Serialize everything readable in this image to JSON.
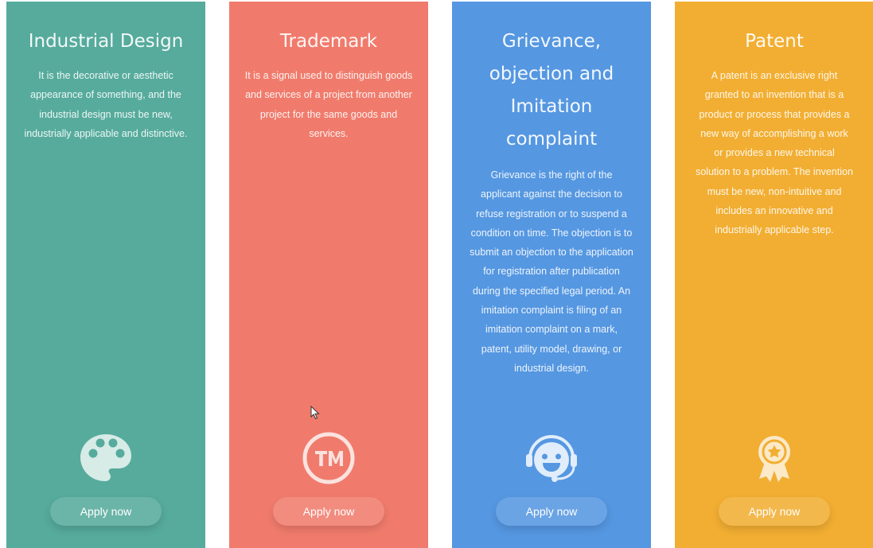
{
  "cards": [
    {
      "title": "Industrial Design",
      "description": "It is the decorative or aesthetic appearance of something, and the industrial design must be new, industrially applicable and distinctive.",
      "icon": "palette-icon",
      "button_label": "Apply now",
      "color": "#56AB9C"
    },
    {
      "title": "Trademark",
      "description": "It is a signal used to distinguish goods and services of a project from another project for the same goods and services.",
      "icon": "trademark-icon",
      "button_label": "Apply now",
      "color": "#F07B6C"
    },
    {
      "title": "Grievance,\nobjection and\nImitation\ncomplaint",
      "description": "Grievance is the right of the applicant against the decision to refuse registration or to suspend a condition on time. The objection is to submit an objection to the application for registration after publication during the specified legal period. An imitation complaint is filing of an imitation complaint on a mark, patent, utility model, drawing, or industrial design.",
      "icon": "support-agent-icon",
      "button_label": "Apply now",
      "color": "#5597E1"
    },
    {
      "title": "Patent",
      "description": "A patent is an exclusive right granted to an invention that is a product or process that provides a new way of accomplishing a work or provides a new technical solution to a problem. The invention must be new, non-intuitive and includes an innovative and industrially applicable step.",
      "icon": "award-ribbon-icon",
      "button_label": "Apply now",
      "color": "#F2AE32"
    }
  ]
}
